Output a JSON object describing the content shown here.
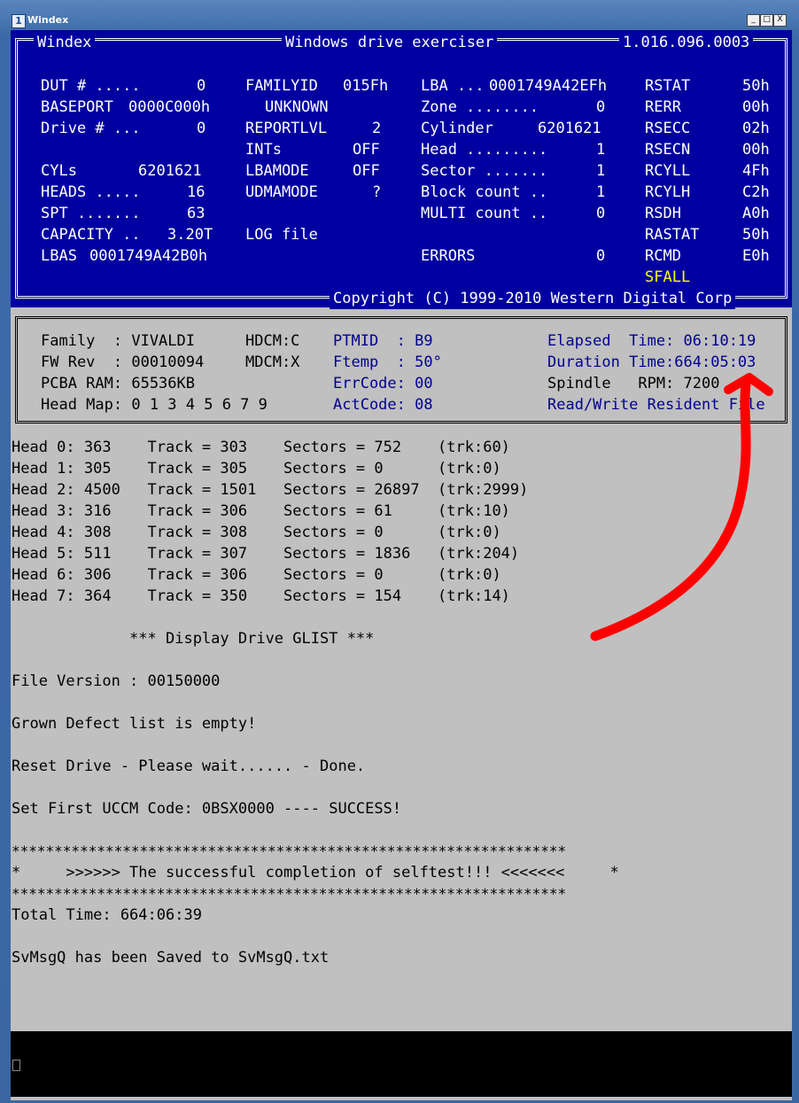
{
  "window": {
    "title": "Windex",
    "icon_label": "1",
    "buttons": [
      "_",
      "□",
      "X"
    ]
  },
  "header": {
    "app": "Windex",
    "subtitle": "Windows drive exerciser",
    "version": "1.016.096.0003",
    "copyright": "Copyright (C) 1999-2010 Western Digital Corp"
  },
  "status": {
    "col1": [
      {
        "label": "DUT # .....",
        "value": "0"
      },
      {
        "label": "BASEPORT",
        "value": "0000C000h"
      },
      {
        "label": "Drive # ...",
        "value": "0"
      },
      {
        "label": "CYLs",
        "value": "6201621"
      },
      {
        "label": "HEADS .....",
        "value": "16"
      },
      {
        "label": "SPT .......",
        "value": "63"
      },
      {
        "label": "CAPACITY ..",
        "value": "3.20T"
      },
      {
        "label": "LBAS",
        "value": "0001749A42B0h"
      }
    ],
    "col2": [
      {
        "label": "FAMILYID",
        "value": "015Fh"
      },
      {
        "label": "",
        "value": "UNKNOWN"
      },
      {
        "label": "REPORTLVL",
        "value": "2"
      },
      {
        "label": "INTs",
        "value": "OFF"
      },
      {
        "label": "LBAMODE",
        "value": "OFF"
      },
      {
        "label": "UDMAMODE",
        "value": "?"
      },
      {
        "label": "LOG file",
        "value": ""
      }
    ],
    "col3": [
      {
        "label": "LBA ...",
        "value": "0001749A42EFh"
      },
      {
        "label": "Zone ........",
        "value": "0"
      },
      {
        "label": "Cylinder",
        "value": "6201621"
      },
      {
        "label": "Head .........",
        "value": "1"
      },
      {
        "label": "Sector .......",
        "value": "1"
      },
      {
        "label": "Block count ..",
        "value": "1"
      },
      {
        "label": "MULTI count ..",
        "value": "0"
      },
      {
        "label": "ERRORS",
        "value": "0"
      }
    ],
    "col4": [
      {
        "label": "RSTAT",
        "value": "50h"
      },
      {
        "label": "RERR",
        "value": "00h"
      },
      {
        "label": "RSECC",
        "value": "02h"
      },
      {
        "label": "RSECN",
        "value": "00h"
      },
      {
        "label": "RCYLL",
        "value": "4Fh"
      },
      {
        "label": "RCYLH",
        "value": "C2h"
      },
      {
        "label": "RSDH",
        "value": "A0h"
      },
      {
        "label": "RASTAT",
        "value": "50h"
      },
      {
        "label": "RCMD",
        "value": "E0h"
      }
    ],
    "flag": "SFALL"
  },
  "drive": {
    "family": "Family  : VIVALDI",
    "fwrev": "FW Rev  : 00010094",
    "pcba": "PCBA RAM: 65536KB",
    "headmap": "Head Map: 0 1 3 4 5 6 7 9",
    "hdcm": "HDCM:C",
    "mdcm": "MDCM:X",
    "ptmid": "PTMID  : B9",
    "ftemp": "Ftemp  : 50°",
    "errcode": "ErrCode: 00",
    "actcode": "ActCode: 08",
    "elapsed": "Elapsed  Time: 06:10:19",
    "duration": "Duration Time:664:05:03",
    "spindle": "Spindle   RPM: 7200",
    "resident": "Read/Write Resident File"
  },
  "heads": [
    "Head 0: 363    Track = 303    Sectors = 752    (trk:60)",
    "Head 1: 305    Track = 305    Sectors = 0      (trk:0)",
    "Head 2: 4500   Track = 1501   Sectors = 26897  (trk:2999)",
    "Head 3: 316    Track = 306    Sectors = 61     (trk:10)",
    "Head 4: 308    Track = 308    Sectors = 0      (trk:0)",
    "Head 5: 511    Track = 307    Sectors = 1836   (trk:204)",
    "Head 6: 306    Track = 306    Sectors = 0      (trk:0)",
    "Head 7: 364    Track = 350    Sectors = 154    (trk:14)"
  ],
  "log": {
    "glist": "             *** Display Drive GLIST ***",
    "file_version": "File Version : 00150000",
    "grown": "Grown Defect list is empty!",
    "reset": "Reset Drive - Please wait...... - Done.",
    "uccm": "Set First UCCM Code: 0BSX0000 ---- SUCCESS!",
    "stars": "*****************************************************************",
    "selftest": "*     >>>>>> The successful completion of selftest!!! <<<<<<<     *",
    "total": "Total Time: 664:06:39",
    "saved": "SvMsgQ has been Saved to SvMsgQ.txt"
  },
  "cmd": {
    "cursor": ""
  },
  "colors": {
    "title_blue": "#0000a0",
    "console_gray": "#c0c0c0",
    "flag_yellow": "#ffff00",
    "label_navy": "#000090",
    "arrow_red": "#ff0000"
  }
}
